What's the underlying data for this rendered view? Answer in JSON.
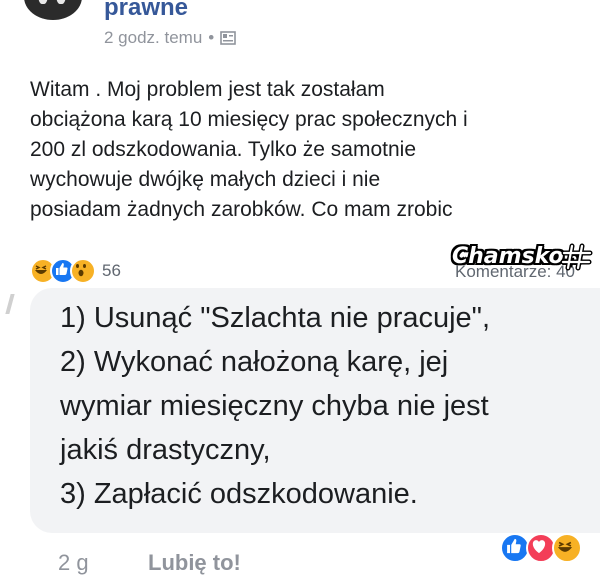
{
  "post": {
    "page_name": "prawne",
    "timestamp": "2 godz. temu",
    "separator": "•",
    "privacy_icon": "public-globe-icon",
    "text_lines": [
      "Witam . Moj problem jest tak zostałam",
      "obciążona karą 10 miesięcy prac społecznych i",
      "200 zl odszkodowania. Tylko że samotnie",
      "wychowuje dwójkę małych dzieci i nie",
      "posiadam żadnych zarobków. Co mam zrobic"
    ]
  },
  "reactions": {
    "icons": [
      "haha-icon",
      "like-icon",
      "wow-icon"
    ],
    "count": "56",
    "comments_label": "Komentarze: 40"
  },
  "watermark": {
    "text": "Chamsko",
    "suffix": ".pl"
  },
  "comment": {
    "lines": [
      "1) Usunąć \"Szlachta nie pracuje\",",
      "2) Wykonać nałożoną karę, jej",
      "wymiar miesięczny chyba nie jest",
      "jakiś drastyczny,",
      "3) Zapłacić odszkodowanie."
    ],
    "time": "2 g",
    "like_label": "Lubię to!",
    "reaction_icons": [
      "like-icon",
      "love-icon",
      "haha-icon"
    ]
  },
  "colors": {
    "link": "#365899",
    "meta": "#90949c",
    "like_blue": "#1877f2",
    "love_red": "#f33e58",
    "haha_yellow": "#f7b125",
    "bubble": "#f2f3f5"
  }
}
